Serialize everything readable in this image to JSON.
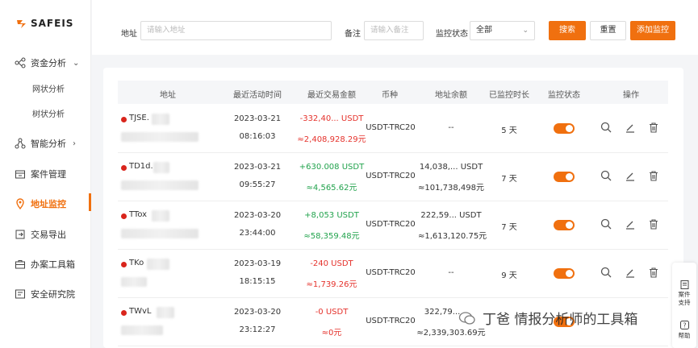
{
  "brand": {
    "name": "SAFEIS",
    "accent": "#f0700f"
  },
  "sidebar": {
    "items": [
      {
        "label": "资金分析",
        "icon": "flow-icon",
        "chevron": "⌄"
      },
      {
        "label": "网状分析"
      },
      {
        "label": "树状分析"
      },
      {
        "label": "智能分析",
        "icon": "nodes-icon",
        "chevron": "›"
      },
      {
        "label": "案件管理",
        "icon": "folder-icon"
      },
      {
        "label": "地址监控",
        "icon": "location-icon",
        "active": true
      },
      {
        "label": "交易导出",
        "icon": "export-icon"
      },
      {
        "label": "办案工具箱",
        "icon": "toolbox-icon"
      },
      {
        "label": "安全研究院",
        "icon": "institute-icon"
      }
    ]
  },
  "filters": {
    "address_label": "地址",
    "address_placeholder": "请输入地址",
    "note_label": "备注",
    "note_placeholder": "请输入备注",
    "status_label": "监控状态",
    "status_value": "全部",
    "search_button": "搜索",
    "reset_button": "重置",
    "add_button": "添加监控"
  },
  "table": {
    "headers": [
      "地址",
      "最近活动时间",
      "最近交易金额",
      "币种",
      "地址余额",
      "已监控时长",
      "监控状态",
      "操作"
    ],
    "rows": [
      {
        "address": "TJSE.",
        "date": "2023-03-21",
        "time": "08:16:03",
        "amount": "-332,40... USDT",
        "amount_cny": "≈2,408,928.29元",
        "amount_type": "out",
        "currency": "USDT-TRC20",
        "balance": "--",
        "balance_cny": "",
        "duration": "5 天"
      },
      {
        "address": "TD1d.",
        "date": "2023-03-21",
        "time": "09:55:27",
        "amount": "+630.008 USDT",
        "amount_cny": "≈4,565.62元",
        "amount_type": "in",
        "currency": "USDT-TRC20",
        "balance": "14,038,...  USDT",
        "balance_cny": "≈101,738,498元",
        "duration": "7 天"
      },
      {
        "address": "TTox",
        "date": "2023-03-20",
        "time": "23:44:00",
        "amount": "+8,053 USDT",
        "amount_cny": "≈58,359.48元",
        "amount_type": "in",
        "currency": "USDT-TRC20",
        "balance": "222,59...  USDT",
        "balance_cny": "≈1,613,120.75元",
        "duration": "7 天"
      },
      {
        "address": "TKo",
        "date": "2023-03-19",
        "time": "18:15:15",
        "amount": "-240 USDT",
        "amount_cny": "≈1,739.26元",
        "amount_type": "out",
        "currency": "USDT-TRC20",
        "balance": "--",
        "balance_cny": "",
        "duration": "9 天"
      },
      {
        "address": "TWvL",
        "date": "2023-03-20",
        "time": "23:12:27",
        "amount": "-0 USDT",
        "amount_cny": "≈0元",
        "amount_type": "out",
        "currency": "USDT-TRC20",
        "balance": "322,79...",
        "balance_cny": "≈2,339,303.69元",
        "duration": ""
      }
    ]
  },
  "float_widgets": {
    "support": "案件\n支持",
    "help": "帮助"
  },
  "watermark": "丁爸 情报分析师的工具箱",
  "colors": {
    "accent": "#f0700f",
    "negative": "#e5322c",
    "positive": "#22a34d"
  }
}
